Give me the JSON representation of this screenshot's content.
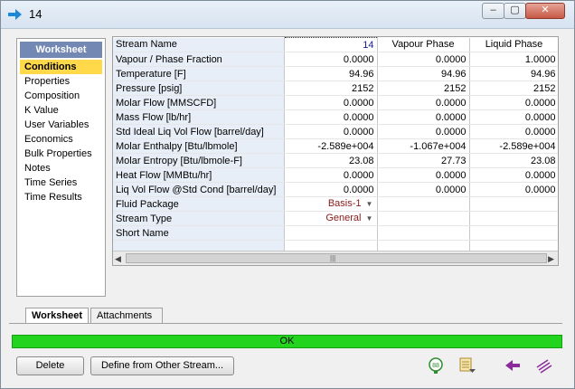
{
  "window": {
    "title": "14",
    "icons": {
      "app": "blue-arrow-icon",
      "min": "minimize-icon",
      "max": "maximize-icon",
      "close": "close-icon"
    }
  },
  "sidebar": {
    "header": "Worksheet",
    "items": [
      {
        "label": "Conditions",
        "active": true
      },
      {
        "label": "Properties"
      },
      {
        "label": "Composition"
      },
      {
        "label": "K Value"
      },
      {
        "label": "User Variables"
      },
      {
        "label": "Economics"
      },
      {
        "label": "Bulk Properties"
      },
      {
        "label": "Notes"
      },
      {
        "label": "Time Series"
      },
      {
        "label": "Time Results"
      }
    ]
  },
  "grid": {
    "header": {
      "label": "Stream Name",
      "value": "14",
      "col2": "Vapour Phase",
      "col3": "Liquid Phase"
    },
    "rows": [
      {
        "label": "Vapour / Phase Fraction",
        "c1": "0.0000",
        "c2": "0.0000",
        "c3": "1.0000"
      },
      {
        "label": "Temperature [F]",
        "c1": "94.96",
        "c2": "94.96",
        "c3": "94.96"
      },
      {
        "label": "Pressure [psig]",
        "c1": "2152",
        "c2": "2152",
        "c3": "2152"
      },
      {
        "label": "Molar Flow [MMSCFD]",
        "c1": "0.0000",
        "c2": "0.0000",
        "c3": "0.0000"
      },
      {
        "label": "Mass Flow [lb/hr]",
        "c1": "0.0000",
        "c2": "0.0000",
        "c3": "0.0000"
      },
      {
        "label": "Std Ideal Liq Vol Flow [barrel/day]",
        "c1": "0.0000",
        "c2": "0.0000",
        "c3": "0.0000"
      },
      {
        "label": "Molar Enthalpy [Btu/lbmole]",
        "c1": "-2.589e+004",
        "c2": "-1.067e+004",
        "c3": "-2.589e+004"
      },
      {
        "label": "Molar Entropy [Btu/lbmole-F]",
        "c1": "23.08",
        "c2": "27.73",
        "c3": "23.08"
      },
      {
        "label": "Heat Flow [MMBtu/hr]",
        "c1": "0.0000",
        "c2": "0.0000",
        "c3": "0.0000"
      },
      {
        "label": "Liq Vol Flow @Std Cond [barrel/day]",
        "c1": "0.0000",
        "c2": "0.0000",
        "c3": "0.0000"
      }
    ],
    "fluid_package": {
      "label": "Fluid Package",
      "value": "Basis-1"
    },
    "stream_type": {
      "label": "Stream Type",
      "value": "General"
    },
    "short_name": {
      "label": "Short Name",
      "value": ""
    }
  },
  "tabs": [
    {
      "label": "Worksheet",
      "active": true
    },
    {
      "label": "Attachments"
    }
  ],
  "status": {
    "text": "OK",
    "color": "#22d41d"
  },
  "buttons": {
    "delete": "Delete",
    "define": "Define from Other Stream...",
    "icons": [
      "stream-badge-88-icon",
      "dropdown-grid-icon",
      "back-arrow-icon",
      "forward-arrow-icon"
    ]
  },
  "colors": {
    "sidebar_header": "#7388b3",
    "active_item": "#ffd94a",
    "label_column": "#e7eef7",
    "package_text": "#8b1a1a"
  }
}
